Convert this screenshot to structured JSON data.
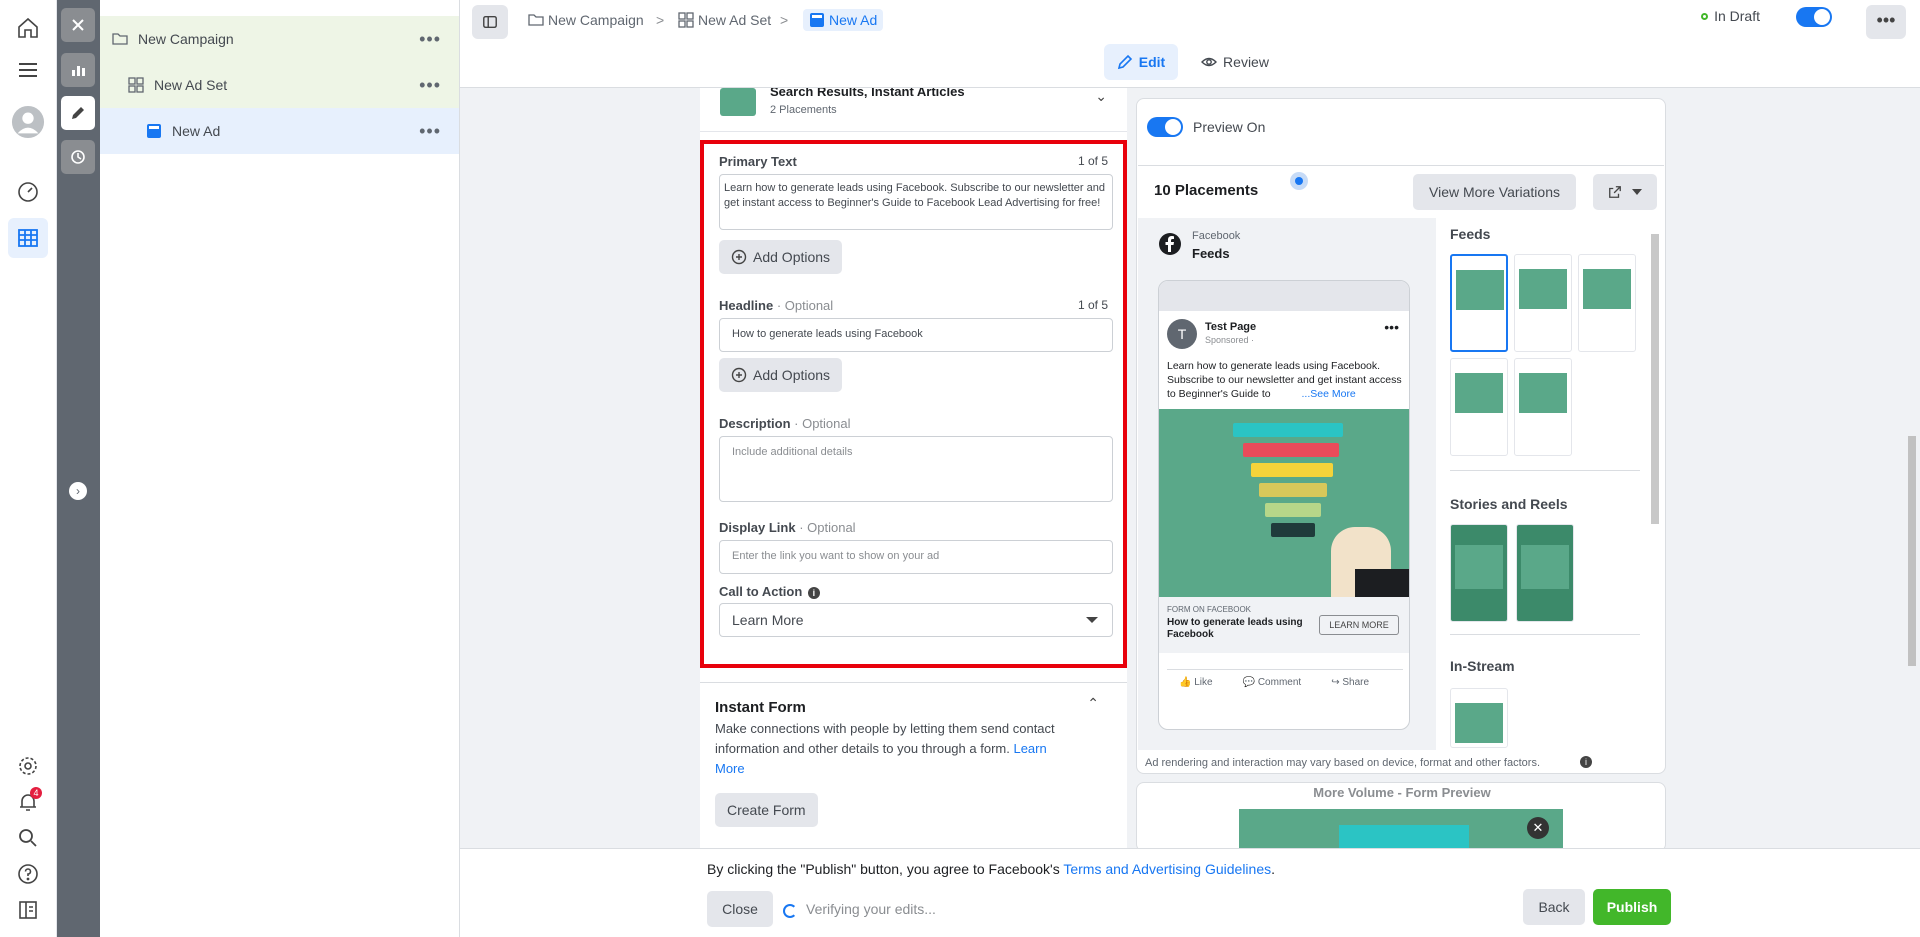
{
  "colors": {
    "accent": "#1877f2",
    "publish": "#42b72a",
    "highlight_border": "#e8000b",
    "ad_image_bg": "#5aa889"
  },
  "tree": {
    "campaign_label": "New Campaign",
    "adset_label": "New Ad Set",
    "ad_label": "New Ad",
    "more_icon": "•••"
  },
  "notifications": {
    "count": "4"
  },
  "breadcrumb": {
    "campaign": "New Campaign",
    "adset": "New Ad Set",
    "ad": "New Ad",
    "separator": ">"
  },
  "topbar": {
    "status": "In Draft",
    "more_icon": "•••",
    "edit_tab": "Edit",
    "review_tab": "Review"
  },
  "placements_header": {
    "title": "Search Results, Instant Articles",
    "subtitle": "2 Placements"
  },
  "form": {
    "primary_text_label": "Primary Text",
    "primary_text_count": "1 of 5",
    "primary_text_value": "Learn how to generate leads using Facebook. Subscribe to our newsletter and get instant access to Beginner's Guide to Facebook Lead Advertising for free!",
    "add_options": "Add Options",
    "headline_label": "Headline",
    "optional_suffix": "· Optional",
    "headline_count": "1 of 5",
    "headline_value": "How to generate leads using Facebook",
    "description_label": "Description",
    "description_placeholder": "Include additional details",
    "display_link_label": "Display Link",
    "display_link_placeholder": "Enter the link you want to show on your ad",
    "cta_label": "Call to Action",
    "cta_value": "Learn More"
  },
  "instant_form": {
    "title": "Instant Form",
    "description": "Make connections with people by letting them send contact information and other details to you through a form.",
    "learn_more_link": "Learn More",
    "create_button": "Create Form"
  },
  "preview": {
    "toggle_label": "Preview On",
    "placements_count": "10 Placements",
    "view_more": "View More Variations",
    "platform": "Facebook",
    "placement_name": "Feeds",
    "page_name": "Test Page",
    "sponsored": "Sponsored ·",
    "post_text": "Learn how to generate leads using Facebook. Subscribe to our newsletter and get instant access to Beginner's Guide to",
    "see_more": "...See More",
    "form_label": "FORM ON FACEBOOK",
    "ad_headline": "How to generate leads using Facebook",
    "ad_cta": "LEARN MORE",
    "like": "Like",
    "comment": "Comment",
    "share": "Share",
    "sections": [
      "Feeds",
      "Stories and Reels",
      "In-Stream"
    ],
    "disclaimer": "Ad rendering and interaction may vary based on device, format and other factors.",
    "form_preview_title": "More Volume - Form Preview"
  },
  "bottombar": {
    "terms_prefix": "By clicking the \"Publish\" button, you agree to Facebook's ",
    "terms_link": "Terms and Advertising Guidelines",
    "terms_suffix": ".",
    "close": "Close",
    "verifying": "Verifying your edits...",
    "back": "Back",
    "publish": "Publish"
  }
}
